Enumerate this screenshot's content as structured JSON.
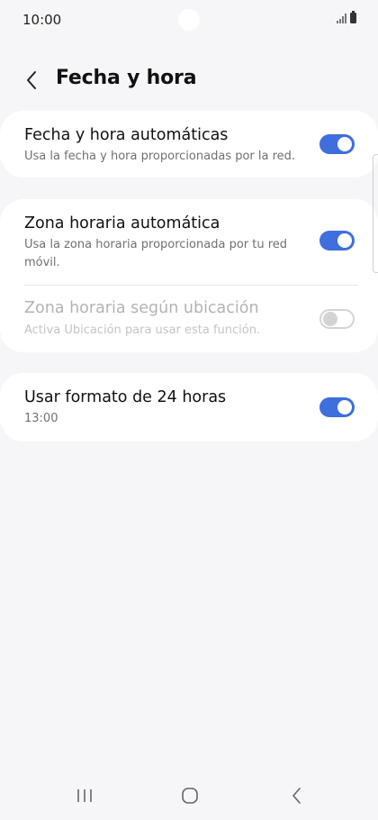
{
  "status_bar": {
    "time": "10:00"
  },
  "header": {
    "title": "Fecha y hora"
  },
  "settings": {
    "auto_datetime": {
      "title": "Fecha y hora automáticas",
      "subtitle": "Usa la fecha y hora proporcionadas por la red.",
      "enabled": true
    },
    "auto_timezone": {
      "title": "Zona horaria automática",
      "subtitle": "Usa la zona horaria proporcionada por tu red móvil.",
      "enabled": true
    },
    "timezone_location": {
      "title": "Zona horaria según ubicación",
      "subtitle": "Activa Ubicación para usar esta función.",
      "enabled": false
    },
    "format_24h": {
      "title": "Usar formato de 24 horas",
      "subtitle": "13:00",
      "enabled": true
    }
  },
  "colors": {
    "accent": "#3e6fdc",
    "background": "#f6f6f8",
    "card": "#ffffff"
  },
  "icons": {
    "back": "chevron-left-icon",
    "recents": "recents-icon",
    "home": "home-icon",
    "nav_back": "nav-back-icon"
  }
}
